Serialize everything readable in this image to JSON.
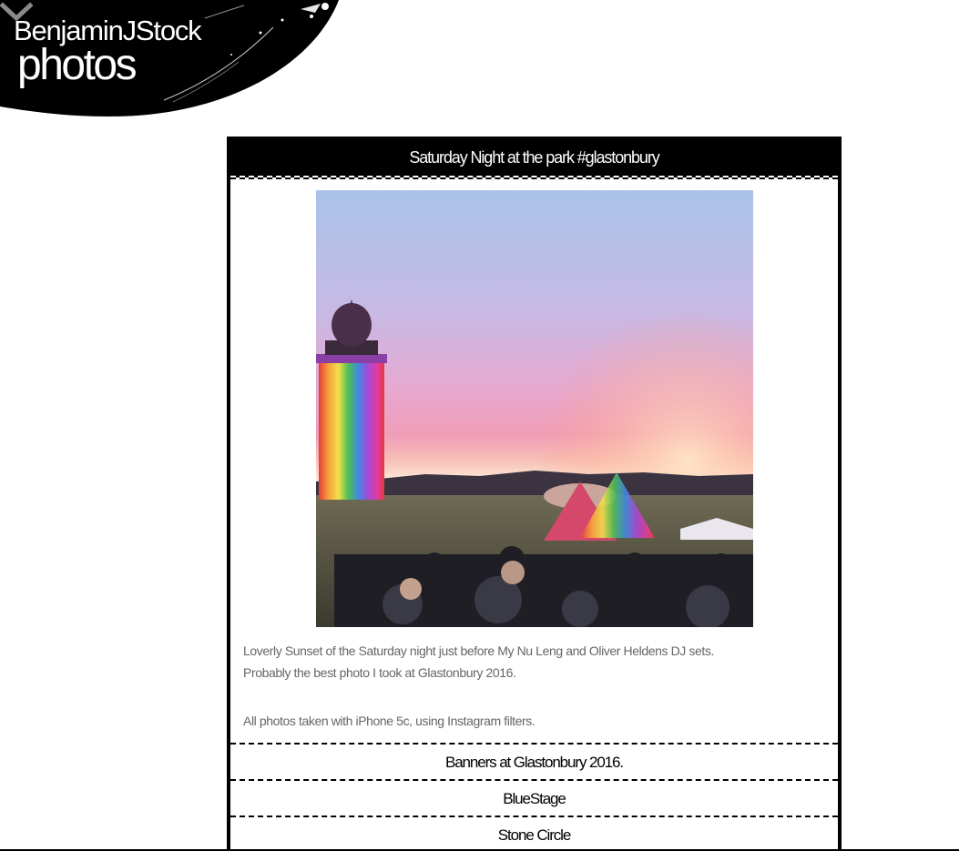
{
  "header": {
    "site_name": "BenjaminJStock",
    "section": "photos",
    "menu_icon": "chevron-down-icon"
  },
  "post": {
    "title": "Saturday Night at the park #glastonbury",
    "caption_line1": "Loverly Sunset of the Saturday night just before My Nu Leng and Oliver Heldens DJ sets.",
    "caption_line2": "Probably the best photo I took at Glastonbury 2016.",
    "caption_line3": "All photos taken with iPhone 5c, using Instagram filters."
  },
  "posts_list": [
    {
      "title": "Banners at Glastonbury 2016."
    },
    {
      "title": "BlueStage"
    },
    {
      "title": "Stone Circle"
    }
  ],
  "colors": {
    "background": "#ffffff",
    "panel_header": "#000000",
    "caption_text": "#666666"
  }
}
